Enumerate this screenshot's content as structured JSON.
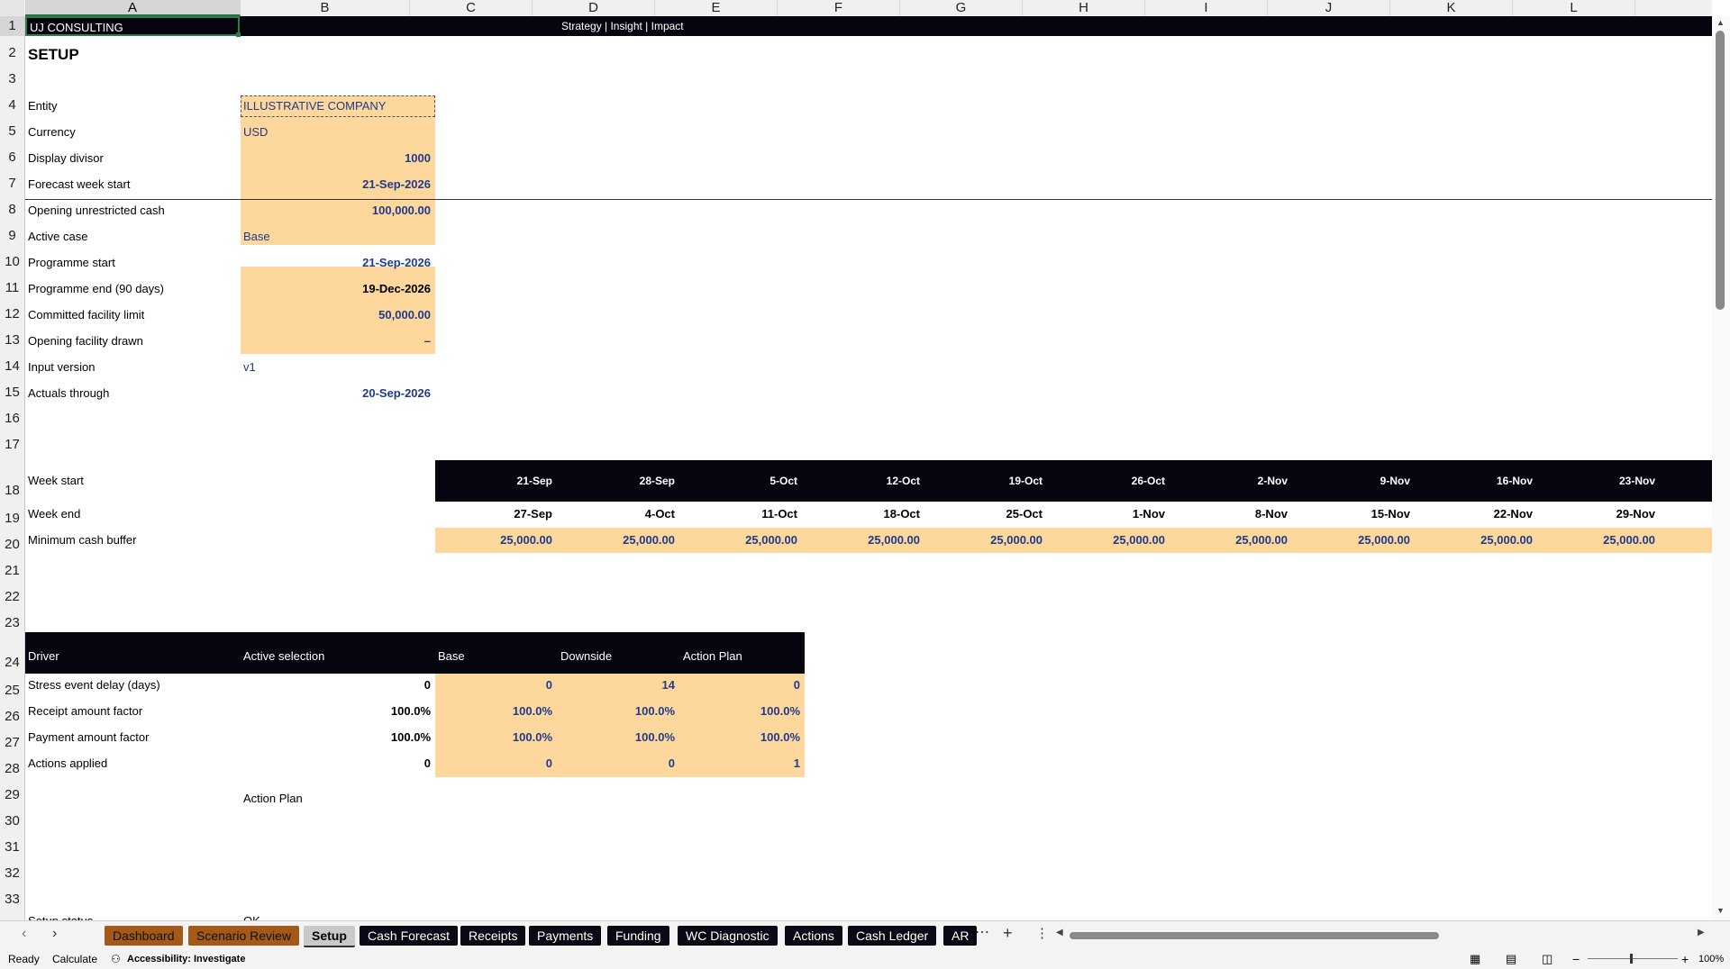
{
  "columns": [
    "A",
    "B",
    "C",
    "D",
    "E",
    "F",
    "G",
    "H",
    "I",
    "J",
    "K",
    "L"
  ],
  "rows": [
    "1",
    "2",
    "3",
    "4",
    "5",
    "6",
    "7",
    "8",
    "9",
    "10",
    "11",
    "12",
    "13",
    "14",
    "15",
    "16",
    "17",
    "18",
    "19",
    "20",
    "21",
    "22",
    "23",
    "24",
    "25",
    "26",
    "27",
    "28",
    "29",
    "30",
    "31",
    "32",
    "33"
  ],
  "banner": {
    "company": "UJ CONSULTING",
    "tagline": "Strategy | Insight | Impact"
  },
  "title": "SETUP",
  "setup": [
    {
      "label": "Entity",
      "value": "ILLUSTRATIVE COMPANY",
      "align": "left",
      "input": true
    },
    {
      "label": "Currency",
      "value": "USD",
      "align": "left",
      "input": true
    },
    {
      "label": "Display divisor",
      "value": "1000",
      "align": "right",
      "input": true
    },
    {
      "label": "Forecast week start",
      "value": "21-Sep-2026",
      "align": "right",
      "input": true
    },
    {
      "label": "Opening unrestricted cash",
      "value": "100,000.00",
      "align": "right",
      "input": true
    },
    {
      "label": "Active case",
      "value": "Base",
      "align": "left",
      "input": true
    },
    {
      "label": "Programme start",
      "value": "21-Sep-2026",
      "align": "right",
      "input": true
    },
    {
      "label": "Programme end (90 days)",
      "value": "19-Dec-2026",
      "align": "right",
      "input": false
    },
    {
      "label": "Committed facility limit",
      "value": "50,000.00",
      "align": "right",
      "input": true
    },
    {
      "label": "Opening facility drawn",
      "value": "–",
      "align": "right",
      "input": true
    },
    {
      "label": "Input version",
      "value": "v1",
      "align": "left",
      "input": true
    },
    {
      "label": "Actuals through",
      "value": "20-Sep-2026",
      "align": "right",
      "input": true
    }
  ],
  "weeks": {
    "start_label": "Week start",
    "end_label": "Week end",
    "buffer_label": "Minimum cash buffer",
    "starts": [
      "21-Sep",
      "28-Sep",
      "5-Oct",
      "12-Oct",
      "19-Oct",
      "26-Oct",
      "2-Nov",
      "9-Nov",
      "16-Nov",
      "23-Nov"
    ],
    "ends": [
      "27-Sep",
      "4-Oct",
      "11-Oct",
      "18-Oct",
      "25-Oct",
      "1-Nov",
      "8-Nov",
      "15-Nov",
      "22-Nov",
      "29-Nov"
    ],
    "buffers": [
      "25,000.00",
      "25,000.00",
      "25,000.00",
      "25,000.00",
      "25,000.00",
      "25,000.00",
      "25,000.00",
      "25,000.00",
      "25,000.00",
      "25,000.00"
    ]
  },
  "drivers": {
    "headers": [
      "Driver",
      "Active selection",
      "Base",
      "Downside",
      "Action Plan"
    ],
    "rows": [
      {
        "label": "Stress event delay (days)",
        "active": "0",
        "base": "0",
        "downside": "14",
        "action": "0"
      },
      {
        "label": "Receipt amount factor",
        "active": "100.0%",
        "base": "100.0%",
        "downside": "100.0%",
        "action": "100.0%"
      },
      {
        "label": "Payment amount factor",
        "active": "100.0%",
        "base": "100.0%",
        "downside": "100.0%",
        "action": "100.0%"
      },
      {
        "label": "Actions applied",
        "active": "0",
        "base": "0",
        "downside": "0",
        "action": "1"
      }
    ],
    "selected_case": "Action Plan"
  },
  "partial_row": {
    "label": "Setup status",
    "value": "OK"
  },
  "tabs": [
    {
      "label": "Dashboard",
      "style": "brown"
    },
    {
      "label": "Scenario Review",
      "style": "brown"
    },
    {
      "label": "Setup",
      "style": "active"
    },
    {
      "label": "Cash Forecast",
      "style": "dark"
    },
    {
      "label": "Receipts",
      "style": "dark"
    },
    {
      "label": "Payments",
      "style": "dark"
    },
    {
      "label": "Funding",
      "style": "dark"
    },
    {
      "label": "WC Diagnostic",
      "style": "dark"
    },
    {
      "label": "Actions",
      "style": "dark"
    },
    {
      "label": "Cash Ledger",
      "style": "dark"
    },
    {
      "label": "AR",
      "style": "dark"
    }
  ],
  "status": {
    "ready": "Ready",
    "calculate": "Calculate",
    "accessibility": "Accessibility: Investigate",
    "zoom": "100%"
  },
  "colors": {
    "input_fill": "#fdd79b",
    "header_fill": "#05050f",
    "input_text": "#1f3b8c",
    "tab_brown": "#a35a18"
  }
}
